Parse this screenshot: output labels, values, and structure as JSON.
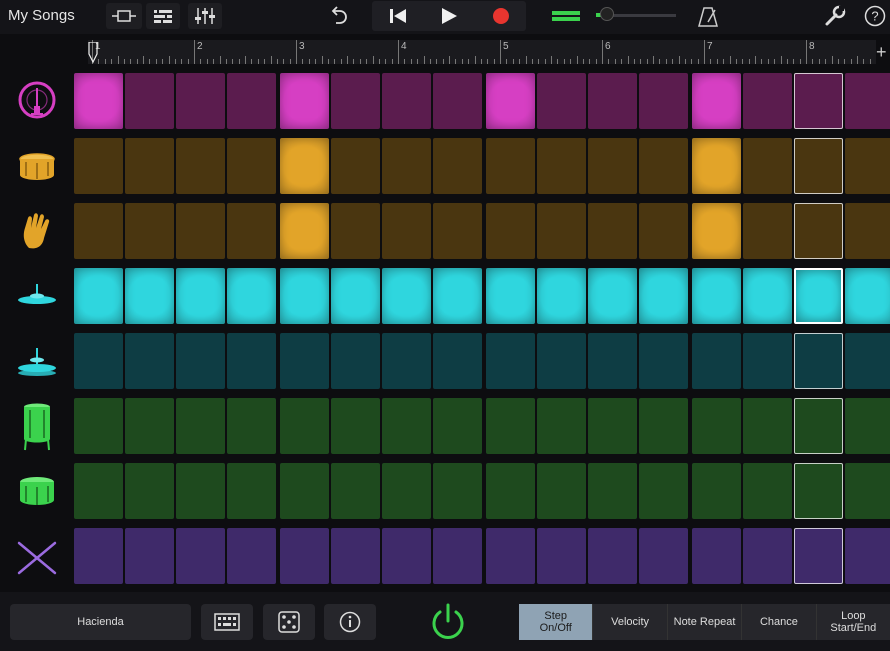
{
  "topbar": {
    "my_songs": "My Songs",
    "icons": [
      "tracks-view-icon",
      "mixer-list-icon",
      "eq-sliders-icon",
      "undo-icon",
      "rewind-icon",
      "play-icon",
      "record-icon",
      "volume-slider",
      "metronome-icon",
      "wrench-icon",
      "help-icon"
    ]
  },
  "ruler": {
    "bars": [
      "1",
      "2",
      "3",
      "4",
      "5",
      "6",
      "7",
      "8"
    ]
  },
  "instruments": [
    "kick-drum",
    "snare-drum",
    "hand-clap",
    "closed-hihat",
    "open-hihat",
    "floor-tom",
    "tom",
    "drumsticks"
  ],
  "colors": {
    "kick_on": "#d63fc3",
    "kick_off": "#5b1c4e",
    "snare_on": "#e2a429",
    "snare_off": "#4a3610",
    "hat_on": "#2fd6de",
    "hat_off": "#0e3d44",
    "tom_off": "#1e4a1e",
    "tom_icon": "#3bd24d",
    "sticks_off": "#3f2a6a",
    "sticks_icon": "#9b6be0",
    "power": "#3bd24d",
    "record": "#e8352f"
  },
  "steps": {
    "kick": [
      1,
      0,
      0,
      0,
      1,
      0,
      0,
      0,
      1,
      0,
      0,
      0,
      1,
      0,
      0,
      0
    ],
    "snare": [
      0,
      0,
      0,
      0,
      1,
      0,
      0,
      0,
      0,
      0,
      0,
      0,
      1,
      0,
      0,
      0
    ],
    "clap": [
      0,
      0,
      0,
      0,
      1,
      0,
      0,
      0,
      0,
      0,
      0,
      0,
      1,
      0,
      0,
      0
    ],
    "closed_hat": [
      1,
      1,
      1,
      1,
      1,
      1,
      1,
      1,
      1,
      1,
      1,
      1,
      1,
      1,
      1,
      1
    ],
    "open_hat": [
      0,
      0,
      0,
      0,
      0,
      0,
      0,
      0,
      0,
      0,
      0,
      0,
      0,
      0,
      0,
      0
    ],
    "floor_tom": [
      0,
      0,
      0,
      0,
      0,
      0,
      0,
      0,
      0,
      0,
      0,
      0,
      0,
      0,
      0,
      0
    ],
    "tom": [
      0,
      0,
      0,
      0,
      0,
      0,
      0,
      0,
      0,
      0,
      0,
      0,
      0,
      0,
      0,
      0
    ],
    "sticks": [
      0,
      0,
      0,
      0,
      0,
      0,
      0,
      0,
      0,
      0,
      0,
      0,
      0,
      0,
      0,
      0
    ]
  },
  "playhead_step": 15,
  "bottom": {
    "preset_name": "Hacienda",
    "modes": [
      {
        "label": "Step On/Off",
        "active": true
      },
      {
        "label": "Velocity",
        "active": false
      },
      {
        "label": "Note Repeat",
        "active": false
      },
      {
        "label": "Chance",
        "active": false
      },
      {
        "label": "Loop Start/End",
        "active": false
      }
    ]
  }
}
